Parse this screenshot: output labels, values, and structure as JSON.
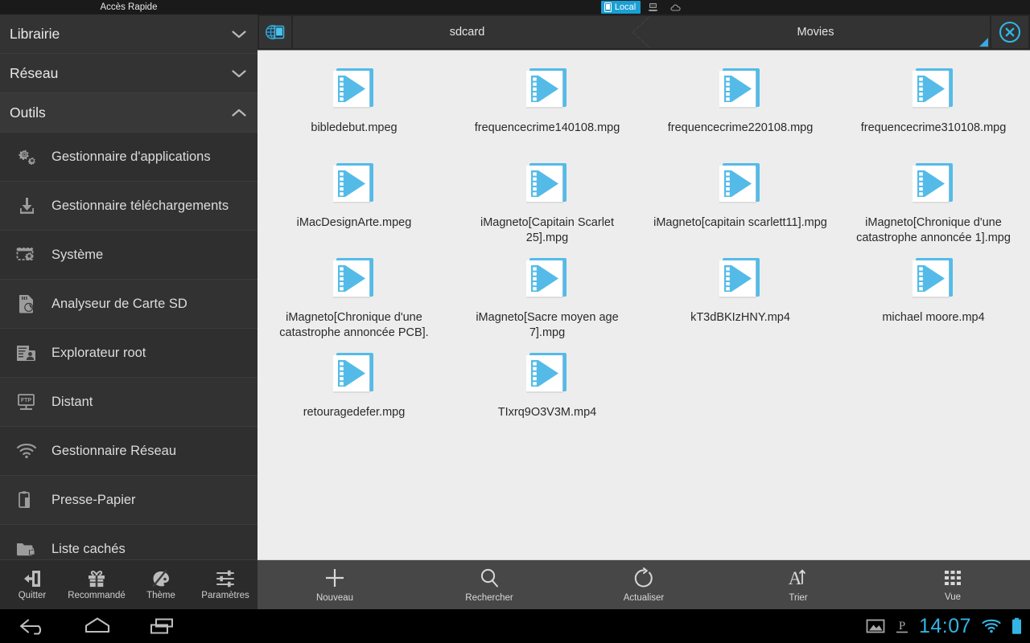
{
  "window": {
    "sidebar_title": "Accès Rapide"
  },
  "location_tabs": [
    {
      "label": "Local",
      "icon": "phone-icon",
      "active": true
    },
    {
      "label": "",
      "icon": "lan-computer-icon",
      "active": false
    },
    {
      "label": "",
      "icon": "cloud-icon",
      "active": false
    }
  ],
  "sidebar": {
    "groups": [
      {
        "label": "Librairie",
        "state": "collapsed",
        "icon": "chevron-down-icon"
      },
      {
        "label": "Réseau",
        "state": "collapsed",
        "icon": "chevron-down-icon"
      },
      {
        "label": "Outils",
        "state": "expanded",
        "icon": "chevron-up-icon"
      }
    ],
    "items": [
      {
        "label": "Gestionnaire d'applications",
        "icon": "gears-icon"
      },
      {
        "label": "Gestionnaire téléchargements",
        "icon": "download-icon"
      },
      {
        "label": "Système",
        "icon": "system-window-gear-icon"
      },
      {
        "label": "Analyseur de Carte SD",
        "icon": "sdcard-analyzer-icon"
      },
      {
        "label": "Explorateur root",
        "icon": "root-explorer-icon"
      },
      {
        "label": "Distant",
        "icon": "ftp-remote-icon"
      },
      {
        "label": "Gestionnaire Réseau",
        "icon": "wifi-icon"
      },
      {
        "label": "Presse-Papier",
        "icon": "clipboard-icon"
      },
      {
        "label": "Liste cachés",
        "icon": "hidden-folder-lock-icon"
      }
    ],
    "dock": [
      {
        "label": "Quitter",
        "icon": "exit-door-icon"
      },
      {
        "label": "Recommandé",
        "icon": "gift-icon"
      },
      {
        "label": "Thème",
        "icon": "palette-icon"
      },
      {
        "label": "Paramètres",
        "icon": "sliders-icon"
      }
    ]
  },
  "breadcrumb": {
    "home_icon": "globe-tablet-icon",
    "crumbs": [
      "sdcard",
      "Movies"
    ],
    "close_icon": "close-circle-icon",
    "resize_handle": "resize-corner-handle"
  },
  "files": [
    {
      "name": "bibledebut.mpeg",
      "type": "video"
    },
    {
      "name": "frequencecrime140108.mpg",
      "type": "video"
    },
    {
      "name": "frequencecrime220108.mpg",
      "type": "video"
    },
    {
      "name": "frequencecrime310108.mpg",
      "type": "video"
    },
    {
      "name": "iMacDesignArte.mpeg",
      "type": "video"
    },
    {
      "name": "iMagneto[Capitain Scarlet 25].mpg",
      "type": "video"
    },
    {
      "name": "iMagneto[capitain scarlett11].mpg",
      "type": "video"
    },
    {
      "name": "iMagneto[Chronique d'une catastrophe annoncée 1].mpg",
      "type": "video"
    },
    {
      "name": "iMagneto[Chronique d'une catastrophe annoncée PCB].",
      "type": "video"
    },
    {
      "name": "iMagneto[Sacre moyen age 7].mpg",
      "type": "video"
    },
    {
      "name": "kT3dBKIzHNY.mp4",
      "type": "video"
    },
    {
      "name": "michael moore.mp4",
      "type": "video"
    },
    {
      "name": "retouragedefer.mpg",
      "type": "video"
    },
    {
      "name": "TIxrq9O3V3M.mp4",
      "type": "video"
    }
  ],
  "main_toolbar": [
    {
      "label": "Nouveau",
      "icon": "plus-icon"
    },
    {
      "label": "Rechercher",
      "icon": "search-icon"
    },
    {
      "label": "Actualiser",
      "icon": "refresh-icon"
    },
    {
      "label": "Trier",
      "icon": "sort-alpha-icon"
    },
    {
      "label": "Vue",
      "icon": "grid-view-icon"
    }
  ],
  "navbar": {
    "buttons": [
      {
        "icon": "back-icon"
      },
      {
        "icon": "home-icon"
      },
      {
        "icon": "recents-icon"
      }
    ],
    "status": {
      "image_icon": "screenshot-image-icon",
      "p_icon": "parking-p-icon",
      "clock": "14:07",
      "wifi_icon": "wifi-icon",
      "battery_icon": "battery-full-icon"
    }
  },
  "colors": {
    "accent_blue": "#33b5e5",
    "icon_blue": "#54bbe8",
    "sidebar_bg": "#333333",
    "content_bg": "#ededed",
    "toolbar_bg": "#474747"
  }
}
